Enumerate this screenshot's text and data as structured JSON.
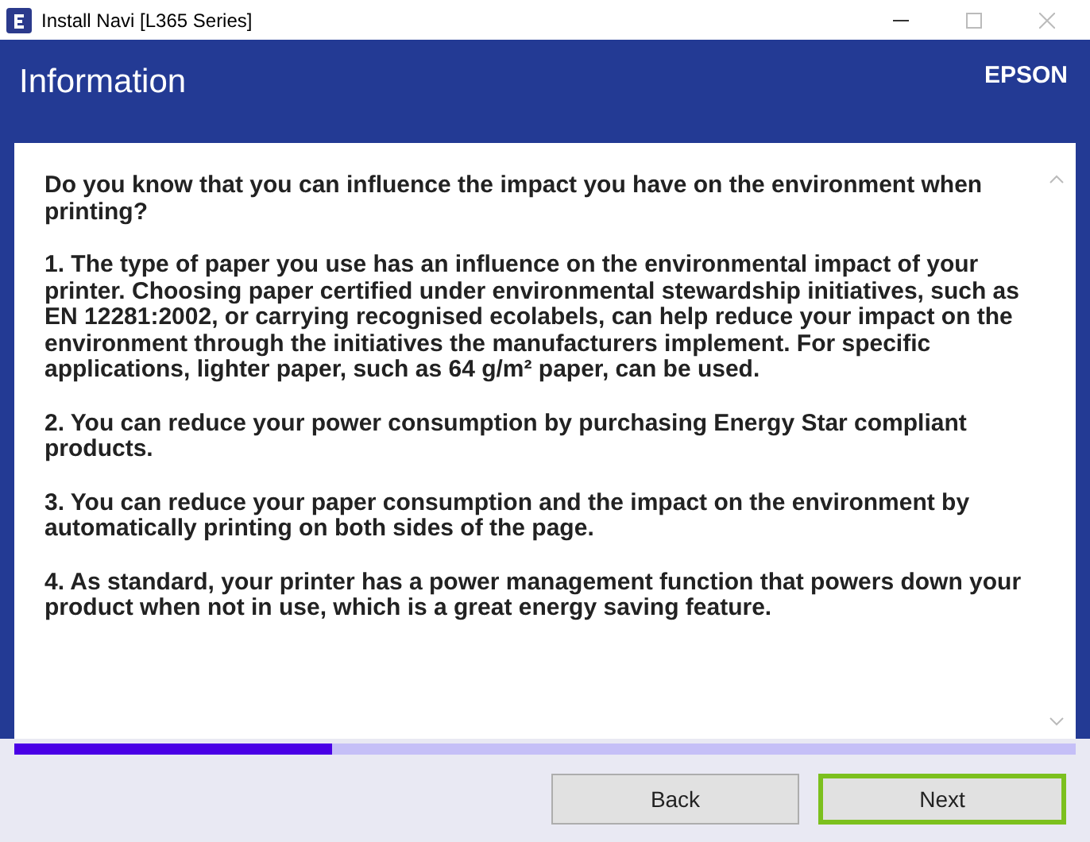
{
  "window": {
    "title": "Install Navi [L365 Series]"
  },
  "header": {
    "title": "Information",
    "brand": "EPSON"
  },
  "paragraphs": [
    "Do you know that you can influence the impact you have on the environment when printing?",
    "1. The type of paper you use has an influence on the environmental impact of your printer. Choosing paper certified under environmental stewardship initiatives, such as EN 12281:2002, or carrying recognised ecolabels, can help reduce your impact on the environment through the initiatives the manufacturers implement. For specific applications, lighter paper, such as 64 g/m² paper, can be used.",
    "2. You can reduce your power consumption by purchasing Energy Star compliant products.",
    "3. You can reduce your paper consumption and the impact on the environment by automatically printing on both sides of the page.",
    "4. As standard, your printer has a power management function that powers down your product when not in use, which is a great energy saving feature."
  ],
  "progress": {
    "level": 0.3
  },
  "buttons": [
    {
      "label": "Back",
      "focused": false
    },
    {
      "label": "Next",
      "focused": true
    }
  ]
}
